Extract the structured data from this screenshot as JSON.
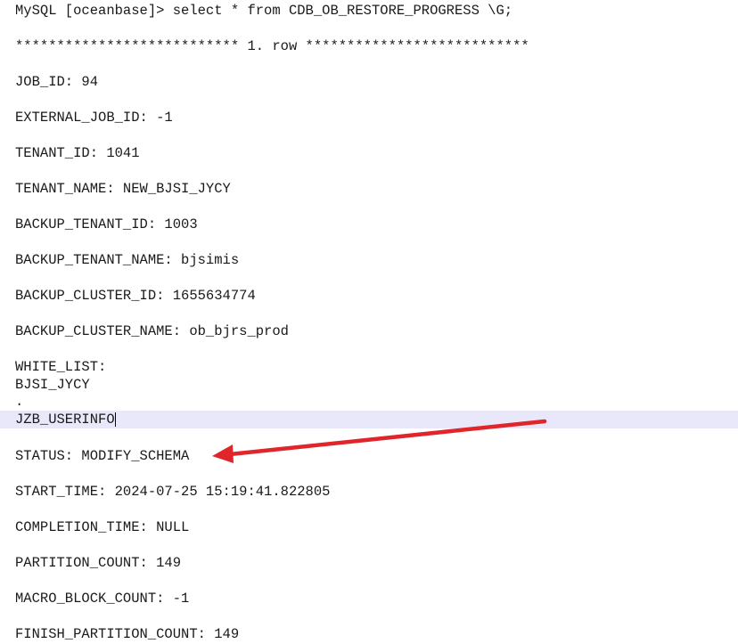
{
  "terminal": {
    "command": "MySQL [oceanbase]> select * from CDB_OB_RESTORE_PROGRESS \\G;",
    "row_separator": "*************************** 1. row ***************************",
    "job_id": "JOB_ID: 94",
    "external_job_id": "EXTERNAL_JOB_ID: -1",
    "tenant_id": "TENANT_ID: 1041",
    "tenant_name": "TENANT_NAME: NEW_BJSI_JYCY",
    "backup_tenant_id": "BACKUP_TENANT_ID: 1003",
    "backup_tenant_name": "BACKUP_TENANT_NAME: bjsimis",
    "backup_cluster_id": "BACKUP_CLUSTER_ID: 1655634774",
    "backup_cluster_name": "BACKUP_CLUSTER_NAME: ob_bjrs_prod",
    "white_list_label": "WHITE_LIST:",
    "white_list_line1": "BJSI_JYCY",
    "white_list_line2": ".",
    "white_list_line3": "JZB_USERINFO",
    "status": "STATUS: MODIFY_SCHEMA",
    "start_time": "START_TIME: 2024-07-25 15:19:41.822805",
    "completion_time": "COMPLETION_TIME: NULL",
    "partition_count": "PARTITION_COUNT: 149",
    "macro_block_count": "MACRO_BLOCK_COUNT: -1",
    "finish_partition_count": "FINISH_PARTITION_COUNT: 149"
  },
  "annotation": {
    "arrow_color": "#e0252b"
  }
}
